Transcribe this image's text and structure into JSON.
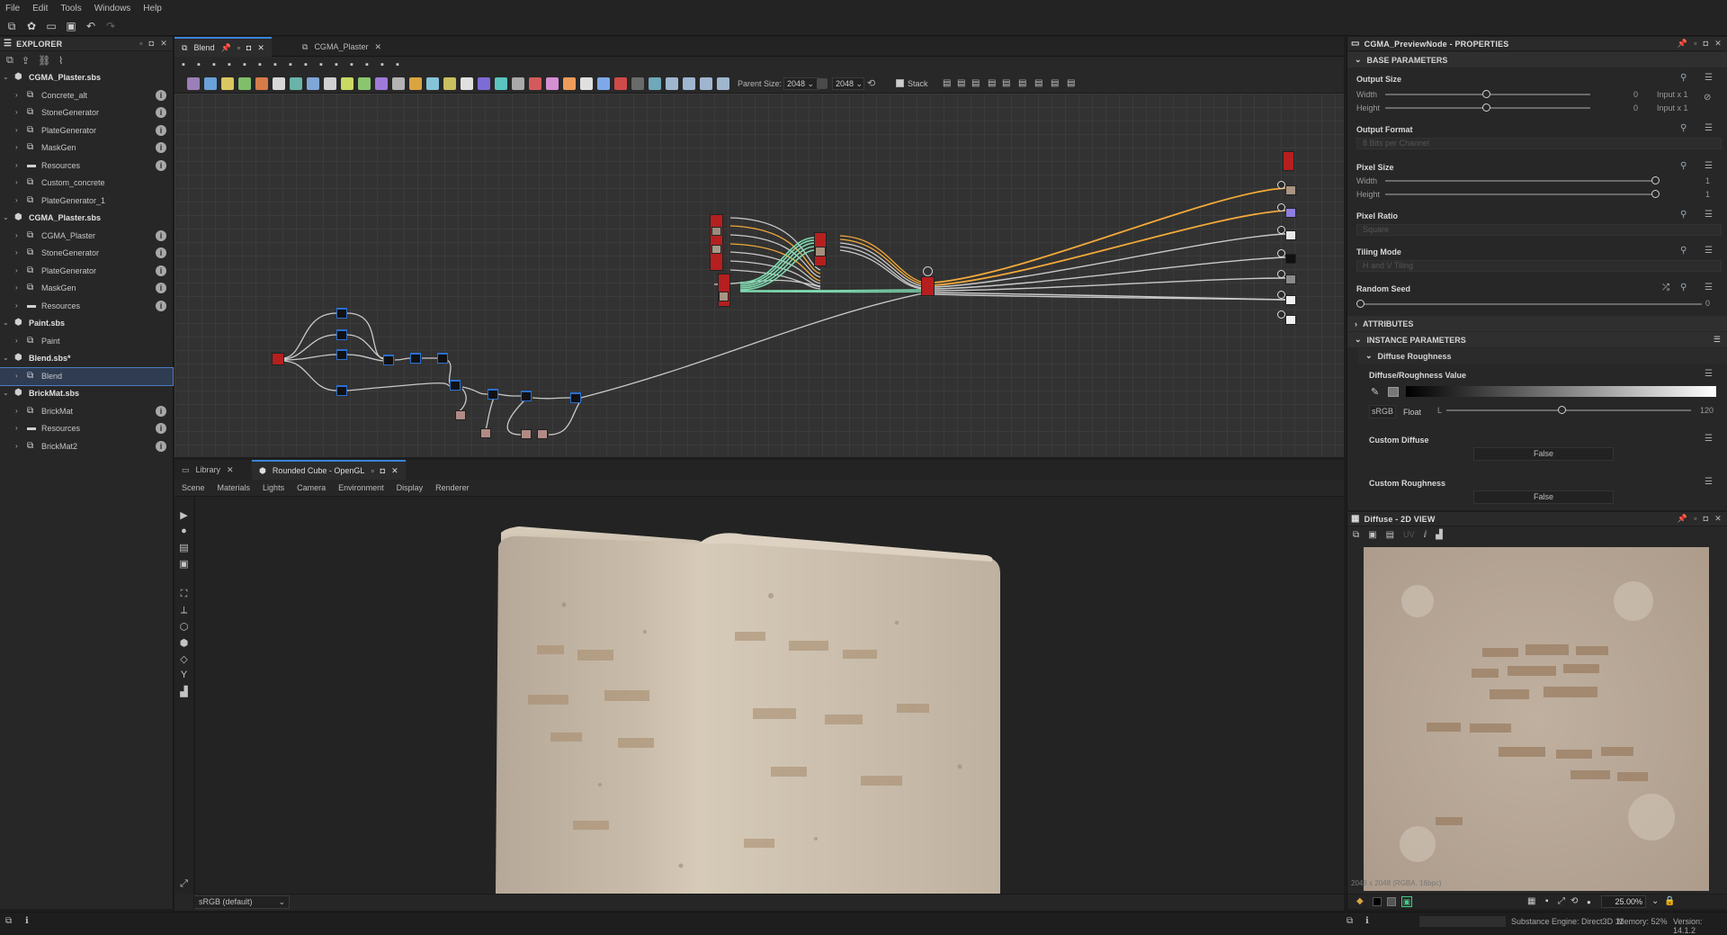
{
  "menu": [
    "File",
    "Edit",
    "Tools",
    "Windows",
    "Help"
  ],
  "explorer": {
    "title": "EXPLORER",
    "items": [
      {
        "label": "CGMA_Plaster.sbs",
        "level": 0,
        "type": "package",
        "info": false
      },
      {
        "label": "Concrete_alt",
        "level": 1,
        "type": "graph",
        "info": true
      },
      {
        "label": "StoneGenerator",
        "level": 1,
        "type": "graph",
        "info": true
      },
      {
        "label": "PlateGenerator",
        "level": 1,
        "type": "graph",
        "info": true
      },
      {
        "label": "MaskGen",
        "level": 1,
        "type": "graph",
        "info": true
      },
      {
        "label": "Resources",
        "level": 1,
        "type": "folder",
        "info": true
      },
      {
        "label": "Custom_concrete",
        "level": 1,
        "type": "graph",
        "info": false
      },
      {
        "label": "PlateGenerator_1",
        "level": 1,
        "type": "graph",
        "info": false
      },
      {
        "label": "CGMA_Plaster.sbs",
        "level": 0,
        "type": "package",
        "info": false
      },
      {
        "label": "CGMA_Plaster",
        "level": 1,
        "type": "graph",
        "info": true
      },
      {
        "label": "StoneGenerator",
        "level": 1,
        "type": "graph",
        "info": true
      },
      {
        "label": "PlateGenerator",
        "level": 1,
        "type": "graph",
        "info": true
      },
      {
        "label": "MaskGen",
        "level": 1,
        "type": "graph",
        "info": true
      },
      {
        "label": "Resources",
        "level": 1,
        "type": "folder",
        "info": true
      },
      {
        "label": "Paint.sbs",
        "level": 0,
        "type": "package",
        "info": false
      },
      {
        "label": "Paint",
        "level": 1,
        "type": "graph",
        "info": false
      },
      {
        "label": "Blend.sbs*",
        "level": 0,
        "type": "package",
        "info": false
      },
      {
        "label": "Blend",
        "level": 1,
        "type": "graph",
        "info": false,
        "selected": true
      },
      {
        "label": "BrickMat.sbs",
        "level": 0,
        "type": "package",
        "info": false
      },
      {
        "label": "BrickMat",
        "level": 1,
        "type": "graph",
        "info": true
      },
      {
        "label": "Resources",
        "level": 1,
        "type": "folder",
        "info": true
      },
      {
        "label": "BrickMat2",
        "level": 1,
        "type": "graph",
        "info": true
      }
    ]
  },
  "graph": {
    "tabs": [
      "Blend",
      "CGMA_Plaster"
    ],
    "parent_size_label": "Parent Size:",
    "parent_size_value": "2048",
    "size_value": "2048",
    "stack_label": "Stack"
  },
  "viewport": {
    "tabs": [
      "Library",
      "Rounded Cube - OpenGL"
    ],
    "menu": [
      "Scene",
      "Materials",
      "Lights",
      "Camera",
      "Environment",
      "Display",
      "Renderer"
    ],
    "colorspace": "sRGB (default)"
  },
  "properties": {
    "title": "CGMA_PreviewNode - PROPERTIES",
    "base_parameters": "BASE PARAMETERS",
    "output_size": {
      "label": "Output Size",
      "width_label": "Width",
      "height_label": "Height",
      "width_value": "0",
      "height_value": "0",
      "width_mode": "Input x 1",
      "height_mode": "Input x 1"
    },
    "output_format": {
      "label": "Output Format",
      "value": "8 Bits per Channel"
    },
    "pixel_size": {
      "label": "Pixel Size",
      "width_label": "Width",
      "height_label": "Height",
      "width_value": "1",
      "height_value": "1"
    },
    "pixel_ratio": {
      "label": "Pixel Ratio",
      "value": "Square"
    },
    "tiling_mode": {
      "label": "Tiling Mode",
      "value": "H and V Tiling"
    },
    "random_seed": {
      "label": "Random Seed",
      "value": "0"
    },
    "attributes": "ATTRIBUTES",
    "instance_parameters": "INSTANCE PARAMETERS",
    "diffuse_roughness": "Diffuse Roughness",
    "diffuse_roughness_value": {
      "label": "Diffuse/Roughness Value",
      "space": "sRGB",
      "type": "Float",
      "channel": "L",
      "value": "120",
      "fraction": 0.47
    },
    "custom_diffuse": {
      "label": "Custom Diffuse",
      "value": "False"
    },
    "custom_roughness": {
      "label": "Custom Roughness",
      "value": "False"
    }
  },
  "view2d": {
    "title": "Diffuse - 2D VIEW",
    "uv_label": "UV",
    "zoom": "25.00%",
    "overlay": "2048 x 2048 (RGBA, 16bpc)"
  },
  "status": {
    "engine": "Substance Engine: Direct3D 11",
    "memory": "Memory: 52%",
    "version": "Version: 14.1.2"
  },
  "colors": {
    "accent": "#3b84d7",
    "wire_orange": "#f2a93a",
    "wire_green": "#7fd9b0",
    "wire_gray": "#c9c9c9",
    "node_red": "#b51f1f"
  }
}
